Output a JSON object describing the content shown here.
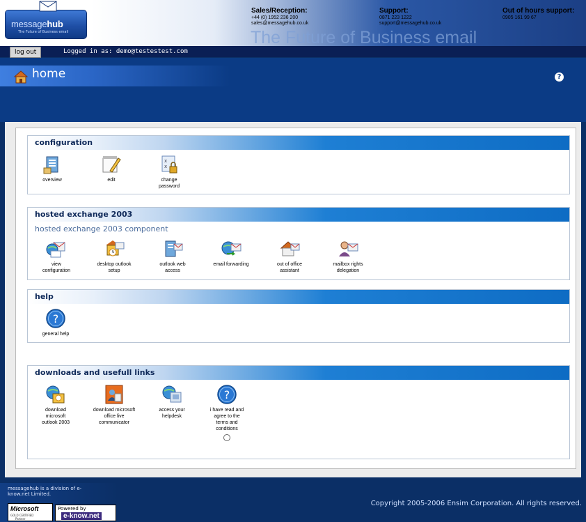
{
  "header": {
    "logo_text_light": "message",
    "logo_text_bold": "hub",
    "logo_tagline": "The Future of Business email",
    "sales": {
      "title": "Sales/Reception:",
      "phone": "+44 (0) 1952 236 200",
      "email": "sales@messagehub.co.uk"
    },
    "support": {
      "title": "Support:",
      "phone": "0871 223 1222",
      "email": "support@messagehub.co.uk"
    },
    "oohs": {
      "title": "Out of hours  support:",
      "phone": "0905 161 99 67"
    },
    "tagline": "The Future of Business email"
  },
  "loginbar": {
    "logout_label": "log out",
    "logged_in_text": "Logged in as: demo@testestest.com"
  },
  "titlebar": {
    "title": "home",
    "help_symbol": "?"
  },
  "sections": {
    "config": {
      "title": "configuration",
      "items": [
        "overview",
        "edit",
        "change password"
      ]
    },
    "hosted": {
      "title": "hosted exchange 2003",
      "subtitle": "hosted exchange 2003 component",
      "items": [
        "view configuration",
        "desktop outlook setup",
        "outlook web access",
        "email forwarding",
        "out of office assistant",
        "mailbox rights delegation"
      ]
    },
    "help": {
      "title": "help",
      "items": [
        "general help"
      ]
    },
    "downloads": {
      "title": "downloads and usefull links",
      "items": [
        "download microsoft outlook 2003",
        "download microsoft office live communicator",
        "access your helpdesk",
        "i have read and agree to the terms and conditions"
      ]
    }
  },
  "footer": {
    "division": "messagehub is a division of e-know.net Limited.",
    "ms_brand": "Microsoft",
    "ms_gold": "GOLD CERTIFIED",
    "ms_partner": "Partner",
    "powered_by": "Powered by",
    "powered_name": "e-know.net",
    "copyright": "Copyright 2005-2006 Ensim Corporation. All rights reserved."
  },
  "colors": {
    "navy": "#0b2f66",
    "title_blue": "#0b3b85",
    "section_blue": "#1e7fd4"
  }
}
